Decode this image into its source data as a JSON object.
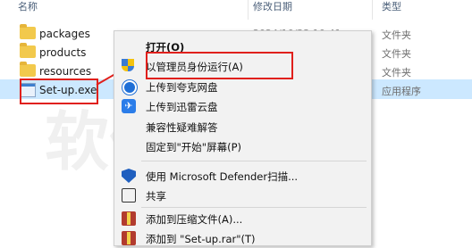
{
  "header": {
    "col_name": "名称",
    "col_date": "修改日期",
    "col_type": "类型"
  },
  "files": [
    {
      "name": "packages",
      "date": "",
      "type": "文件夹",
      "icon": "folder-icon"
    },
    {
      "name": "products",
      "date": "",
      "type": "文件夹",
      "icon": "folder-icon"
    },
    {
      "name": "resources",
      "date": "",
      "type": "文件夹",
      "icon": "folder-icon"
    },
    {
      "name": "Set-up.exe",
      "date": "",
      "type": "应用程序",
      "icon": "exe-icon",
      "selected": true
    }
  ],
  "partial_date": "2024/10/22 10:41",
  "context_menu": {
    "items": [
      {
        "label": "打开(O)",
        "icon": "",
        "bold": true
      },
      {
        "label": "以管理员身份运行(A)",
        "icon": "uac-shield-icon"
      },
      {
        "label": "上传到夸克网盘",
        "icon": "quark-icon"
      },
      {
        "label": "上传到迅雷云盘",
        "icon": "xunlei-icon"
      },
      {
        "label": "兼容性疑难解答",
        "icon": ""
      },
      {
        "label": "固定到\"开始\"屏幕(P)",
        "icon": ""
      },
      {
        "label": "使用 Microsoft Defender扫描...",
        "icon": "defender-icon"
      },
      {
        "label": "共享",
        "icon": "share-icon"
      },
      {
        "label": "添加到压缩文件(A)...",
        "icon": "winrar-icon"
      },
      {
        "label": "添加到 \"Set-up.rar\"(T)",
        "icon": "winrar-icon"
      }
    ]
  },
  "colors": {
    "selection": "#cce8ff",
    "highlight_red": "#e0201c",
    "menu_bg": "#f2f2f2"
  },
  "watermark": "软件自学网"
}
